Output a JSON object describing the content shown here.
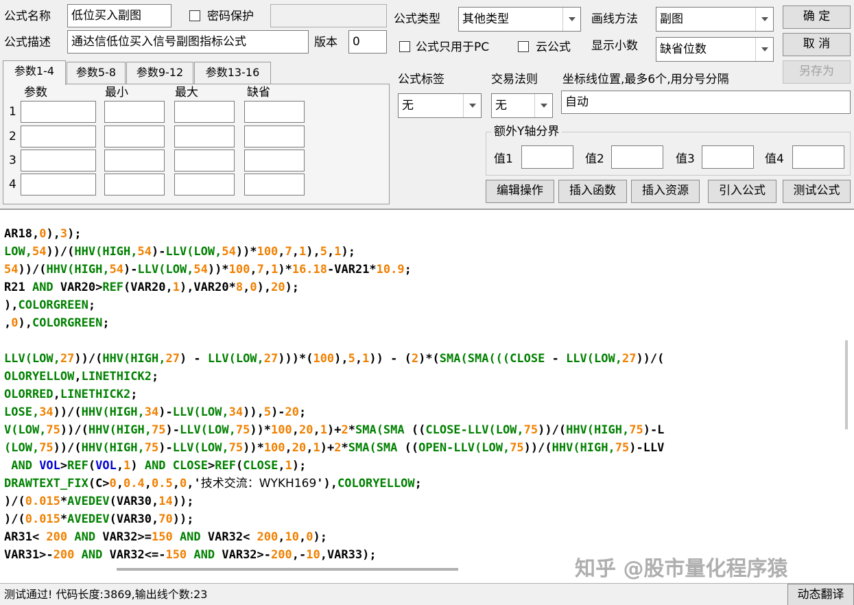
{
  "form": {
    "name_label": "公式名称",
    "name_value": "低位买入副图",
    "password_label": "密码保护",
    "desc_label": "公式描述",
    "desc_value": "通达信低位买入信号副图指标公式",
    "version_label": "版本",
    "version_value": "0",
    "type_label": "公式类型",
    "type_value": "其他类型",
    "draw_label": "画线方法",
    "draw_value": "副图",
    "pc_only_label": "公式只用于PC",
    "cloud_label": "云公式",
    "decimal_label": "显示小数",
    "decimal_value": "缺省位数",
    "tag_label": "公式标签",
    "tag_value": "无",
    "rule_label": "交易法则",
    "rule_value": "无",
    "axis_label": "坐标线位置,最多6个,用分号分隔",
    "axis_value": "自动",
    "extra_y_label": "额外Y轴分界",
    "v1_label": "值1",
    "v2_label": "值2",
    "v3_label": "值3",
    "v4_label": "值4"
  },
  "buttons": {
    "ok": "确  定",
    "cancel": "取  消",
    "save_as": "另存为",
    "edit_ops": "编辑操作",
    "insert_func": "插入函数",
    "insert_res": "插入资源",
    "import_formula": "引入公式",
    "test_formula": "测试公式",
    "dynamic_translate": "动态翻译"
  },
  "tabs": [
    "参数1-4",
    "参数5-8",
    "参数9-12",
    "参数13-16"
  ],
  "param_headers": [
    "参数",
    "最小",
    "最大",
    "缺省"
  ],
  "param_rows": [
    "1",
    "2",
    "3",
    "4"
  ],
  "code_lines": [
    [
      [
        "k",
        "AR18,"
      ],
      [
        "o",
        "0"
      ],
      [
        "k",
        "),"
      ],
      [
        "o",
        "3"
      ],
      [
        "k",
        ");"
      ]
    ],
    [
      [
        "g",
        "LOW,"
      ],
      [
        "o",
        "54"
      ],
      [
        "k",
        "))/("
      ],
      [
        "g",
        "HHV(HIGH,"
      ],
      [
        "o",
        "54"
      ],
      [
        "k",
        ")-"
      ],
      [
        "g",
        "LLV(LOW,"
      ],
      [
        "o",
        "54"
      ],
      [
        "k",
        "))*"
      ],
      [
        "o",
        "100"
      ],
      [
        "k",
        ","
      ],
      [
        "o",
        "7"
      ],
      [
        "k",
        ","
      ],
      [
        "o",
        "1"
      ],
      [
        "k",
        "),"
      ],
      [
        "o",
        "5"
      ],
      [
        "k",
        ","
      ],
      [
        "o",
        "1"
      ],
      [
        "k",
        ");"
      ]
    ],
    [
      [
        "o",
        "54"
      ],
      [
        "k",
        "))/("
      ],
      [
        "g",
        "HHV(HIGH,"
      ],
      [
        "o",
        "54"
      ],
      [
        "k",
        ")-"
      ],
      [
        "g",
        "LLV(LOW,"
      ],
      [
        "o",
        "54"
      ],
      [
        "k",
        "))*"
      ],
      [
        "o",
        "100"
      ],
      [
        "k",
        ","
      ],
      [
        "o",
        "7"
      ],
      [
        "k",
        ","
      ],
      [
        "o",
        "1"
      ],
      [
        "k",
        ")*"
      ],
      [
        "o",
        "16.18"
      ],
      [
        "k",
        "-VAR21*"
      ],
      [
        "o",
        "10.9"
      ],
      [
        "k",
        ";"
      ]
    ],
    [
      [
        "k",
        "R21 "
      ],
      [
        "g",
        "AND"
      ],
      [
        "k",
        " VAR20>"
      ],
      [
        "g",
        "REF"
      ],
      [
        "k",
        "(VAR20,"
      ],
      [
        "o",
        "1"
      ],
      [
        "k",
        "),VAR20*"
      ],
      [
        "o",
        "8"
      ],
      [
        "k",
        ","
      ],
      [
        "o",
        "0"
      ],
      [
        "k",
        "),"
      ],
      [
        "o",
        "20"
      ],
      [
        "k",
        ");"
      ]
    ],
    [
      [
        "k",
        "),"
      ],
      [
        "g",
        "COLORGREEN"
      ],
      [
        "k",
        ";"
      ]
    ],
    [
      [
        "k",
        ","
      ],
      [
        "o",
        "0"
      ],
      [
        "k",
        "),"
      ],
      [
        "g",
        "COLORGREEN"
      ],
      [
        "k",
        ";"
      ]
    ],
    [
      [
        "k",
        " "
      ]
    ],
    [
      [
        "g",
        "LLV(LOW,"
      ],
      [
        "o",
        "27"
      ],
      [
        "k",
        "))/("
      ],
      [
        "g",
        "HHV(HIGH,"
      ],
      [
        "o",
        "27"
      ],
      [
        "k",
        ") - "
      ],
      [
        "g",
        "LLV(LOW,"
      ],
      [
        "o",
        "27"
      ],
      [
        "k",
        ")))*("
      ],
      [
        "o",
        "100"
      ],
      [
        "k",
        "),"
      ],
      [
        "o",
        "5"
      ],
      [
        "k",
        ","
      ],
      [
        "o",
        "1"
      ],
      [
        "k",
        ")) - ("
      ],
      [
        "o",
        "2"
      ],
      [
        "k",
        ")*("
      ],
      [
        "g",
        "SMA(SMA((("
      ],
      [
        "g",
        "CLOSE"
      ],
      [
        "k",
        " - "
      ],
      [
        "g",
        "LLV(LOW,"
      ],
      [
        "o",
        "27"
      ],
      [
        "k",
        "))/("
      ]
    ],
    [
      [
        "g",
        "OLORYELLOW"
      ],
      [
        "k",
        ","
      ],
      [
        "g",
        "LINETHICK2"
      ],
      [
        "k",
        ";"
      ]
    ],
    [
      [
        "g",
        "OLORRED"
      ],
      [
        "k",
        ","
      ],
      [
        "g",
        "LINETHICK2"
      ],
      [
        "k",
        ";"
      ]
    ],
    [
      [
        "g",
        "LOSE,"
      ],
      [
        "o",
        "34"
      ],
      [
        "k",
        "))/("
      ],
      [
        "g",
        "HHV(HIGH,"
      ],
      [
        "o",
        "34"
      ],
      [
        "k",
        ")-"
      ],
      [
        "g",
        "LLV(LOW,"
      ],
      [
        "o",
        "34"
      ],
      [
        "k",
        ")),"
      ],
      [
        "o",
        "5"
      ],
      [
        "k",
        ")-"
      ],
      [
        "o",
        "20"
      ],
      [
        "k",
        ";"
      ]
    ],
    [
      [
        "g",
        "V(LOW,"
      ],
      [
        "o",
        "75"
      ],
      [
        "k",
        "))/("
      ],
      [
        "g",
        "HHV(HIGH,"
      ],
      [
        "o",
        "75"
      ],
      [
        "k",
        ")-"
      ],
      [
        "g",
        "LLV(LOW,"
      ],
      [
        "o",
        "75"
      ],
      [
        "k",
        "))*"
      ],
      [
        "o",
        "100"
      ],
      [
        "k",
        ","
      ],
      [
        "o",
        "20"
      ],
      [
        "k",
        ","
      ],
      [
        "o",
        "1"
      ],
      [
        "k",
        ")+"
      ],
      [
        "o",
        "2"
      ],
      [
        "k",
        "*"
      ],
      [
        "g",
        "SMA(SMA"
      ],
      [
        "k",
        " (("
      ],
      [
        "g",
        "CLOSE-LLV(LOW,"
      ],
      [
        "o",
        "75"
      ],
      [
        "k",
        "))/("
      ],
      [
        "g",
        "HHV(HIGH,"
      ],
      [
        "o",
        "75"
      ],
      [
        "k",
        ")-L"
      ]
    ],
    [
      [
        "g",
        "(LOW,"
      ],
      [
        "o",
        "75"
      ],
      [
        "k",
        "))/("
      ],
      [
        "g",
        "HHV(HIGH,"
      ],
      [
        "o",
        "75"
      ],
      [
        "k",
        ")-"
      ],
      [
        "g",
        "LLV(LOW,"
      ],
      [
        "o",
        "75"
      ],
      [
        "k",
        "))*"
      ],
      [
        "o",
        "100"
      ],
      [
        "k",
        ","
      ],
      [
        "o",
        "20"
      ],
      [
        "k",
        ","
      ],
      [
        "o",
        "1"
      ],
      [
        "k",
        ")+"
      ],
      [
        "o",
        "2"
      ],
      [
        "k",
        "*"
      ],
      [
        "g",
        "SMA(SMA"
      ],
      [
        "k",
        " (("
      ],
      [
        "g",
        "OPEN-LLV(LOW,"
      ],
      [
        "o",
        "75"
      ],
      [
        "k",
        "))/("
      ],
      [
        "g",
        "HHV(HIGH,"
      ],
      [
        "o",
        "75"
      ],
      [
        "k",
        ")-LLV"
      ]
    ],
    [
      [
        "g",
        " AND"
      ],
      [
        "b",
        " VOL"
      ],
      [
        "k",
        ">"
      ],
      [
        "g",
        "REF"
      ],
      [
        "k",
        "("
      ],
      [
        "b",
        "VOL"
      ],
      [
        "k",
        ","
      ],
      [
        "o",
        "1"
      ],
      [
        "k",
        ") "
      ],
      [
        "g",
        "AND"
      ],
      [
        "k",
        " "
      ],
      [
        "g",
        "CLOSE"
      ],
      [
        "k",
        ">"
      ],
      [
        "g",
        "REF"
      ],
      [
        "k",
        "("
      ],
      [
        "g",
        "CLOSE"
      ],
      [
        "k",
        ","
      ],
      [
        "o",
        "1"
      ],
      [
        "k",
        ");"
      ]
    ],
    [
      [
        "g",
        "DRAWTEXT_FIX"
      ],
      [
        "k",
        "(C>"
      ],
      [
        "o",
        "0"
      ],
      [
        "k",
        ","
      ],
      [
        "o",
        "0.4"
      ],
      [
        "k",
        ","
      ],
      [
        "o",
        "0.5"
      ],
      [
        "k",
        ","
      ],
      [
        "o",
        "0"
      ],
      [
        "k",
        ",'"
      ],
      [
        "z",
        "技术交流：WYKH169"
      ],
      [
        "k",
        "'),"
      ],
      [
        "g",
        "COLORYELLOW"
      ],
      [
        "k",
        ";"
      ]
    ],
    [
      [
        "k",
        ")/("
      ],
      [
        "o",
        "0.015"
      ],
      [
        "k",
        "*"
      ],
      [
        "g",
        "AVEDEV"
      ],
      [
        "k",
        "(VAR30,"
      ],
      [
        "o",
        "14"
      ],
      [
        "k",
        "));"
      ]
    ],
    [
      [
        "k",
        ")/("
      ],
      [
        "o",
        "0.015"
      ],
      [
        "k",
        "*"
      ],
      [
        "g",
        "AVEDEV"
      ],
      [
        "k",
        "(VAR30,"
      ],
      [
        "o",
        "70"
      ],
      [
        "k",
        "));"
      ]
    ],
    [
      [
        "k",
        "AR31< "
      ],
      [
        "o",
        "200"
      ],
      [
        "g",
        " AND"
      ],
      [
        "k",
        " VAR32>="
      ],
      [
        "o",
        "150"
      ],
      [
        "g",
        " AND"
      ],
      [
        "k",
        " VAR32< "
      ],
      [
        "o",
        "200"
      ],
      [
        "k",
        ","
      ],
      [
        "o",
        "10"
      ],
      [
        "k",
        ","
      ],
      [
        "o",
        "0"
      ],
      [
        "k",
        ");"
      ]
    ],
    [
      [
        "k",
        "VAR31>-"
      ],
      [
        "o",
        "200"
      ],
      [
        "g",
        " AND"
      ],
      [
        "k",
        " VAR32<=-"
      ],
      [
        "o",
        "150"
      ],
      [
        "g",
        " AND"
      ],
      [
        "k",
        " VAR32>-"
      ],
      [
        "o",
        "200"
      ],
      [
        "k",
        ",-"
      ],
      [
        "o",
        "10"
      ],
      [
        "k",
        ",VAR33);"
      ]
    ]
  ],
  "status": {
    "text": "测试通过! 代码长度:3869,输出线个数:23"
  },
  "watermark": "知乎 @股市量化程序猿"
}
